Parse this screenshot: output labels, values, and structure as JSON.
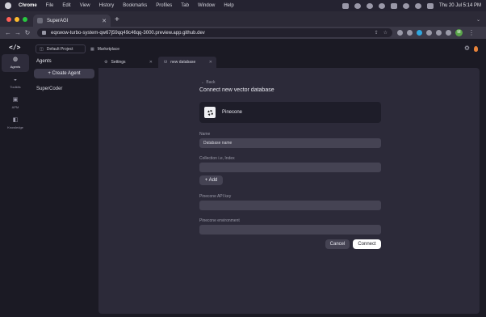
{
  "menubar": {
    "items": [
      "Chrome",
      "File",
      "Edit",
      "View",
      "History",
      "Bookmarks",
      "Profiles",
      "Tab",
      "Window",
      "Help"
    ],
    "clock": "Thu 20 Jul  5:14 PM"
  },
  "browser": {
    "tab_title": "SuperAGI",
    "new_tab": "+",
    "url": "eqxwow-turbo-system-qw67j59qq49c46qq-3000.preview.app.github.dev",
    "avatar_initial": "M",
    "colors": {
      "close": "#ff5f57",
      "minimize": "#febc2e",
      "zoom": "#28c840"
    }
  },
  "app": {
    "logo": "</>",
    "rail": [
      {
        "label": "Agents",
        "icon": "agents-icon",
        "active": true
      },
      {
        "label": "Toolkits",
        "icon": "toolkits-icon",
        "active": false
      },
      {
        "label": "APM",
        "icon": "apm-icon",
        "active": false
      },
      {
        "label": "Knowledge",
        "icon": "knowledge-icon",
        "active": false
      }
    ],
    "project": "Default Project",
    "marketplace": "Marketplace",
    "agents": {
      "title": "Agents",
      "create_button": "+ Create Agent",
      "items": [
        "SuperCoder"
      ]
    },
    "workspace_tabs": [
      {
        "label": "Settings",
        "active": false
      },
      {
        "label": "new database",
        "active": true
      }
    ]
  },
  "form": {
    "back": "← Back",
    "title": "Connect new vector database",
    "db_name": "Pinecone",
    "name_label": "Name",
    "name_placeholder": "Database name",
    "collection_label": "Collection i.e, Index",
    "add_button": "+ Add",
    "api_key_label": "Pinecone API key",
    "env_label": "Pinecone environment",
    "cancel_button": "Cancel",
    "connect_button": "Connect"
  }
}
